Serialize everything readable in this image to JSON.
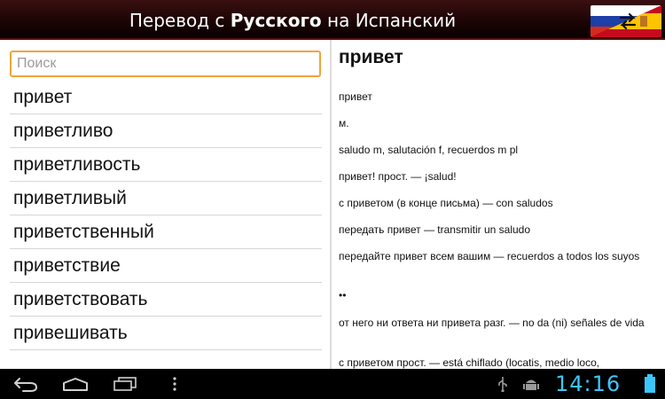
{
  "header": {
    "title_prefix": "Перевод с ",
    "title_from": "Русского",
    "title_middle": " на ",
    "title_to": "Испанский",
    "flag_icon": "ru-es-swap-flag-icon"
  },
  "search": {
    "placeholder": "Поиск",
    "value": ""
  },
  "word_list": [
    "привет",
    "приветливо",
    "приветливость",
    "приветливый",
    "приветственный",
    "приветствие",
    "приветствовать",
    "привешивать"
  ],
  "entry": {
    "headword": "привет",
    "lines": [
      "привет",
      "м.",
      "saludo m, salutación f, recuerdos m pl",
      "привет! прост. — ¡salud!",
      "с приветом (в конце письма) — con saludos",
      "передать привет — transmitir un saludo",
      "передайте привет всем вашим — recuerdos a todos los suyos",
      "••",
      "от него ни ответа ни привета разг. — no da (ni) señales de vida",
      "с приветом прост. — está chiflado (locatis, medio loco,"
    ]
  },
  "navbar": {
    "time": "14:16",
    "icons": [
      "back-icon",
      "home-icon",
      "recent-apps-icon",
      "menu-icon",
      "usb-icon",
      "android-debug-icon",
      "battery-icon"
    ]
  },
  "colors": {
    "header_bg": "#1c0505",
    "search_border": "#f0a43a",
    "clock": "#3cc6ff"
  }
}
